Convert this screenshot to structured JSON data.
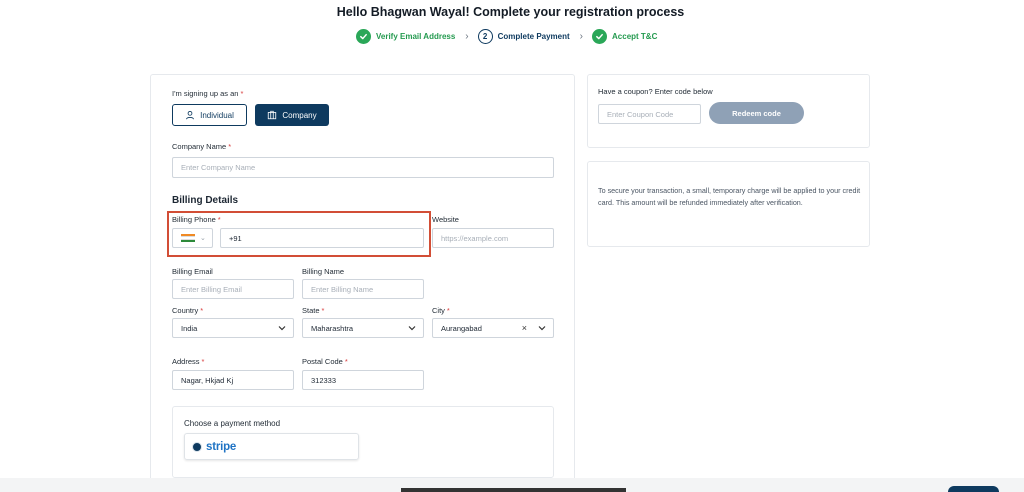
{
  "header": {
    "title": "Hello Bhagwan Wayal! Complete your registration process"
  },
  "steps": [
    {
      "label": "Verify Email Address",
      "state": "done"
    },
    {
      "number": "2",
      "label": "Complete Payment",
      "state": "current"
    },
    {
      "label": "Accept T&C",
      "state": "done"
    }
  ],
  "signup": {
    "label": "I'm signing up as an",
    "required_mark": "*",
    "options": [
      "Individual",
      "Company"
    ],
    "selected": "Company"
  },
  "company": {
    "label": "Company Name",
    "required_mark": "*",
    "placeholder": "Enter Company Name"
  },
  "billing": {
    "title": "Billing Details",
    "phone": {
      "label": "Billing Phone",
      "required_mark": "*",
      "value": "+91"
    },
    "website": {
      "label": "Website",
      "placeholder": "https://example.com"
    },
    "email": {
      "label": "Billing Email",
      "placeholder": "Enter Billing Email"
    },
    "name": {
      "label": "Billing Name",
      "placeholder": "Enter Billing Name"
    },
    "country": {
      "label": "Country",
      "required_mark": "*",
      "value": "India"
    },
    "state": {
      "label": "State",
      "required_mark": "*",
      "value": "Maharashtra"
    },
    "city": {
      "label": "City",
      "required_mark": "*",
      "value": "Aurangabad",
      "clear_glyph": "×"
    },
    "address": {
      "label": "Address",
      "required_mark": "*",
      "value": "Nagar, Hkjad Kj"
    },
    "postal": {
      "label": "Postal Code",
      "required_mark": "*",
      "value": "312333"
    }
  },
  "payment": {
    "label": "Choose a payment method",
    "option": "stripe"
  },
  "coupon": {
    "label": "Have a coupon? Enter code below",
    "placeholder": "Enter Coupon Code",
    "button": "Redeem code"
  },
  "notice": {
    "text": "To secure your transaction, a small, temporary charge will be applied to your credit card. This amount will be refunded immediately after verification."
  },
  "colors": {
    "primary": "#0e3a5f",
    "success": "#2aa758",
    "highlight": "#d24e36",
    "redeem_disabled": "#8fa1b6",
    "stripe": "#1f73c4"
  },
  "icons": {
    "step_done": "check-circle-icon",
    "individual": "user-icon",
    "company": "building-icon",
    "select": "chevron-down-icon",
    "flag": "india-flag-icon"
  }
}
